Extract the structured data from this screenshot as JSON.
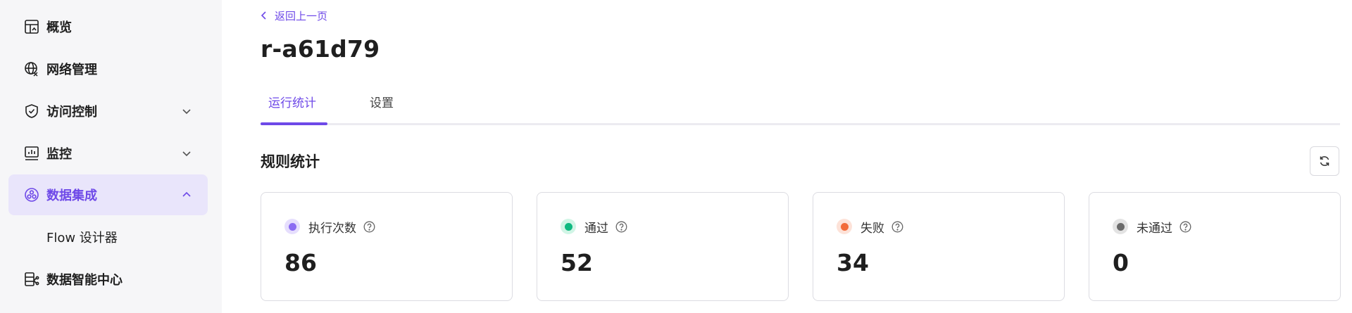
{
  "sidebar": {
    "items": [
      {
        "label": "概览",
        "icon": "dashboard-icon"
      },
      {
        "label": "网络管理",
        "icon": "globe-icon"
      },
      {
        "label": "访问控制",
        "icon": "shield-check-icon"
      },
      {
        "label": "监控",
        "icon": "monitor-chart-icon"
      },
      {
        "label": "数据集成",
        "icon": "data-integration-icon"
      },
      {
        "label": "Flow 设计器",
        "icon": ""
      },
      {
        "label": "数据智能中心",
        "icon": "data-intelligence-icon"
      }
    ],
    "active_item": "数据集成"
  },
  "header": {
    "back_label": "返回上一页",
    "title": "r-a61d79"
  },
  "tabs": [
    {
      "label": "运行统计",
      "active": true
    },
    {
      "label": "设置",
      "active": false
    }
  ],
  "section": {
    "title": "规则统计",
    "refresh_icon": "refresh-icon"
  },
  "stats": [
    {
      "label": "执行次数",
      "value": "86",
      "color": "#8b6cf2",
      "ring": "#e6defd"
    },
    {
      "label": "通过",
      "value": "52",
      "color": "#10b981",
      "ring": "#d1f5e6"
    },
    {
      "label": "失败",
      "value": "34",
      "color": "#f26b3a",
      "ring": "#fde2d8"
    },
    {
      "label": "未通过",
      "value": "0",
      "color": "#6b6b6b",
      "ring": "#e3e3e3"
    }
  ],
  "colors": {
    "accent": "#6e49e8",
    "sidebar_bg": "#f6f6f8",
    "active_bg": "#e9e5fb"
  }
}
